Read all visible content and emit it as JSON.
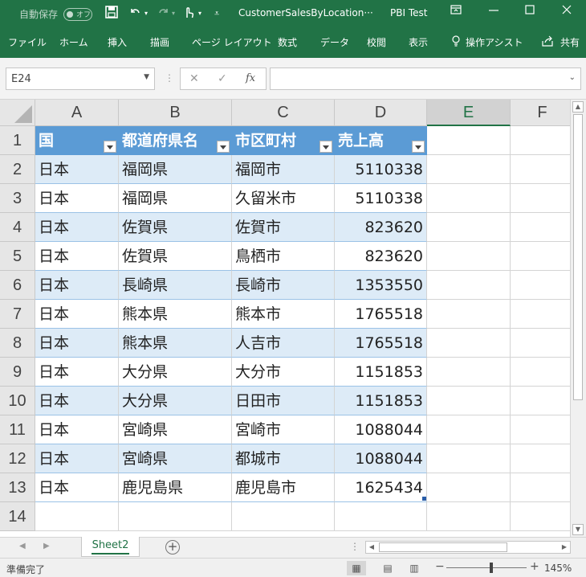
{
  "titlebar": {
    "autosave_label": "自動保存",
    "autosave_state": "オフ",
    "customize_glyph": "⩡",
    "filename": "CustomerSalesByLocation···",
    "account": "PBI Test"
  },
  "ribbon": {
    "tabs": [
      "ファイル",
      "ホーム",
      "挿入",
      "描画",
      "ページ レイアウト",
      "数式",
      "データ",
      "校閲",
      "表示"
    ],
    "tell_me": "操作アシスト",
    "share": "共有"
  },
  "formula_bar": {
    "name_box": "E24",
    "fx": "fx",
    "cancel": "✕",
    "enter": "✓",
    "formula": ""
  },
  "grid": {
    "columns": [
      "A",
      "B",
      "C",
      "D",
      "E",
      "F"
    ],
    "selected_column": "E",
    "rows": [
      "1",
      "2",
      "3",
      "4",
      "5",
      "6",
      "7",
      "8",
      "9",
      "10",
      "11",
      "12",
      "13",
      "14"
    ],
    "table_headers": [
      "国",
      "都道府県名",
      "市区町村",
      "売上高"
    ],
    "table_rows": [
      [
        "日本",
        "福岡県",
        "福岡市",
        "5110338"
      ],
      [
        "日本",
        "福岡県",
        "久留米市",
        "5110338"
      ],
      [
        "日本",
        "佐賀県",
        "佐賀市",
        "823620"
      ],
      [
        "日本",
        "佐賀県",
        "鳥栖市",
        "823620"
      ],
      [
        "日本",
        "長崎県",
        "長崎市",
        "1353550"
      ],
      [
        "日本",
        "熊本県",
        "熊本市",
        "1765518"
      ],
      [
        "日本",
        "熊本県",
        "人吉市",
        "1765518"
      ],
      [
        "日本",
        "大分県",
        "大分市",
        "1151853"
      ],
      [
        "日本",
        "大分県",
        "日田市",
        "1151853"
      ],
      [
        "日本",
        "宮崎県",
        "宮崎市",
        "1088044"
      ],
      [
        "日本",
        "宮崎県",
        "都城市",
        "1088044"
      ],
      [
        "日本",
        "鹿児島県",
        "鹿児島市",
        "1625434"
      ]
    ]
  },
  "sheets": {
    "tabs": [
      "Sheet2"
    ],
    "active": "Sheet2"
  },
  "statusbar": {
    "status": "準備完了",
    "zoom": "145%"
  },
  "colors": {
    "excel_green": "#217346",
    "table_header": "#5b9bd5",
    "table_band": "#ddebf7"
  }
}
